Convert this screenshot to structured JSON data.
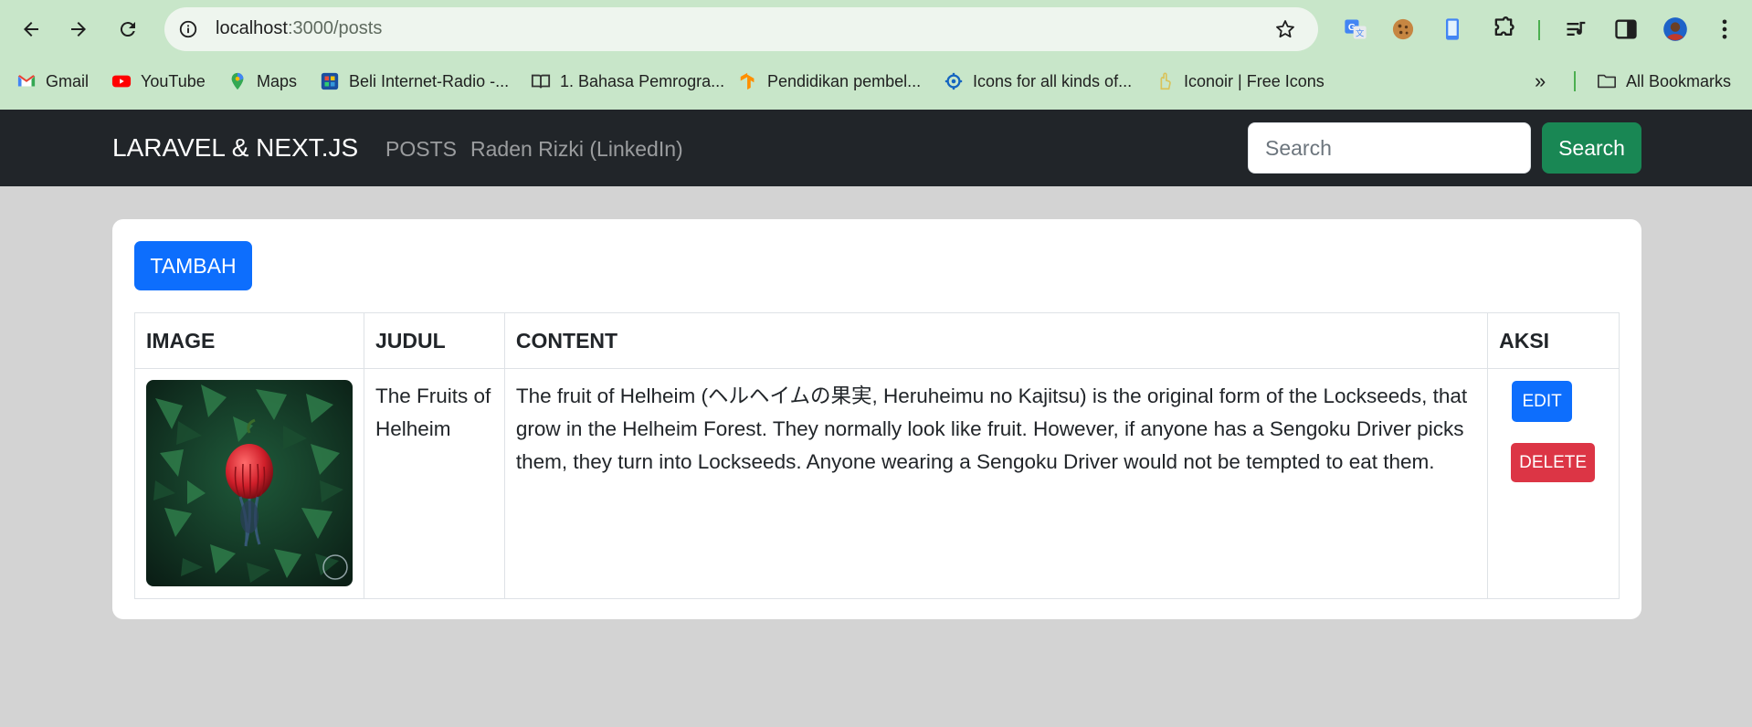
{
  "browser": {
    "url_host": "localhost",
    "url_path": ":3000/posts",
    "bookmarks": [
      {
        "label": "Gmail",
        "icon": "gmail-icon"
      },
      {
        "label": "YouTube",
        "icon": "youtube-icon"
      },
      {
        "label": "Maps",
        "icon": "maps-icon"
      },
      {
        "label": "Beli Internet-Radio -...",
        "icon": "radio-icon"
      },
      {
        "label": "1. Bahasa Pemrogra...",
        "icon": "book-icon"
      },
      {
        "label": "Pendidikan pembel...",
        "icon": "tensorflow-icon"
      },
      {
        "label": "Icons for all kinds of...",
        "icon": "icons-site-icon"
      },
      {
        "label": "Iconoir | Free Icons",
        "icon": "iconoir-icon"
      }
    ],
    "all_bookmarks_label": "All Bookmarks",
    "accent_color": "#c8e6c9"
  },
  "navbar": {
    "brand": "LARAVEL & NEXT.JS",
    "links": [
      "POSTS",
      "Raden Rizki (LinkedIn)"
    ],
    "search_placeholder": "Search",
    "search_button": "Search",
    "background": "#212529"
  },
  "main": {
    "add_button": "TAMBAH",
    "table": {
      "headers": [
        "IMAGE",
        "JUDUL",
        "CONTENT",
        "AKSI"
      ],
      "rows": [
        {
          "image": "post-thumbnail",
          "judul": "The Fruits of Helheim",
          "content": "The fruit of Helheim (ヘルヘイムの果実, Heruheimu no Kajitsu) is the original form of the Lockseeds, that grow in the Helheim Forest. They normally look like fruit. However, if anyone has a Sengoku Driver picks them, they turn into Lockseeds. Anyone wearing a Sengoku Driver would not be tempted to eat them.",
          "edit_label": "EDIT",
          "delete_label": "DELETE"
        }
      ]
    }
  },
  "colors": {
    "primary": "#0d6efd",
    "success": "#198754",
    "danger": "#dc3545",
    "page_bg": "#d3d3d3"
  }
}
